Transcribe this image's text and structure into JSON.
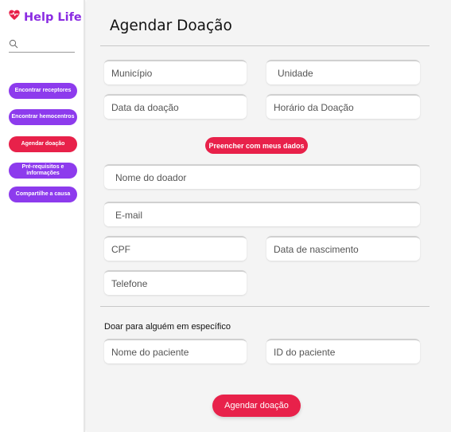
{
  "colors": {
    "brand": "#8a2be2",
    "purple_button": "#8d3bed",
    "red_button": "#e8214a",
    "main_bg": "#f4f4f4"
  },
  "sidebar": {
    "logo_text": "Help Life",
    "logo_icon": "heart-pulse-icon",
    "search_icon": "search-icon",
    "nav": [
      {
        "label": "Encontrar receptores",
        "active": false
      },
      {
        "label": "Encontrar hemocentros",
        "active": false
      },
      {
        "label": "Agendar doação",
        "active": true
      },
      {
        "label": "Pré-requisitos e informações",
        "active": false
      },
      {
        "label": "Compartilhe a causa",
        "active": false
      }
    ]
  },
  "main": {
    "title": "Agendar Doação",
    "fields": {
      "municipio": "Município",
      "unidade": "Unidade",
      "data_doacao": "Data da doação",
      "horario_doacao": "Horário da Doação",
      "nome_doador": "Nome do doador",
      "email": "E-mail",
      "cpf": "CPF",
      "data_nascimento": "Data de nascimento",
      "telefone": "Telefone",
      "nome_paciente": "Nome do paciente",
      "id_paciente": "ID do paciente"
    },
    "fill_button": "Preencher com meus dados",
    "specific_label": "Doar para alguém em específico",
    "submit_button": "Agendar doação"
  }
}
